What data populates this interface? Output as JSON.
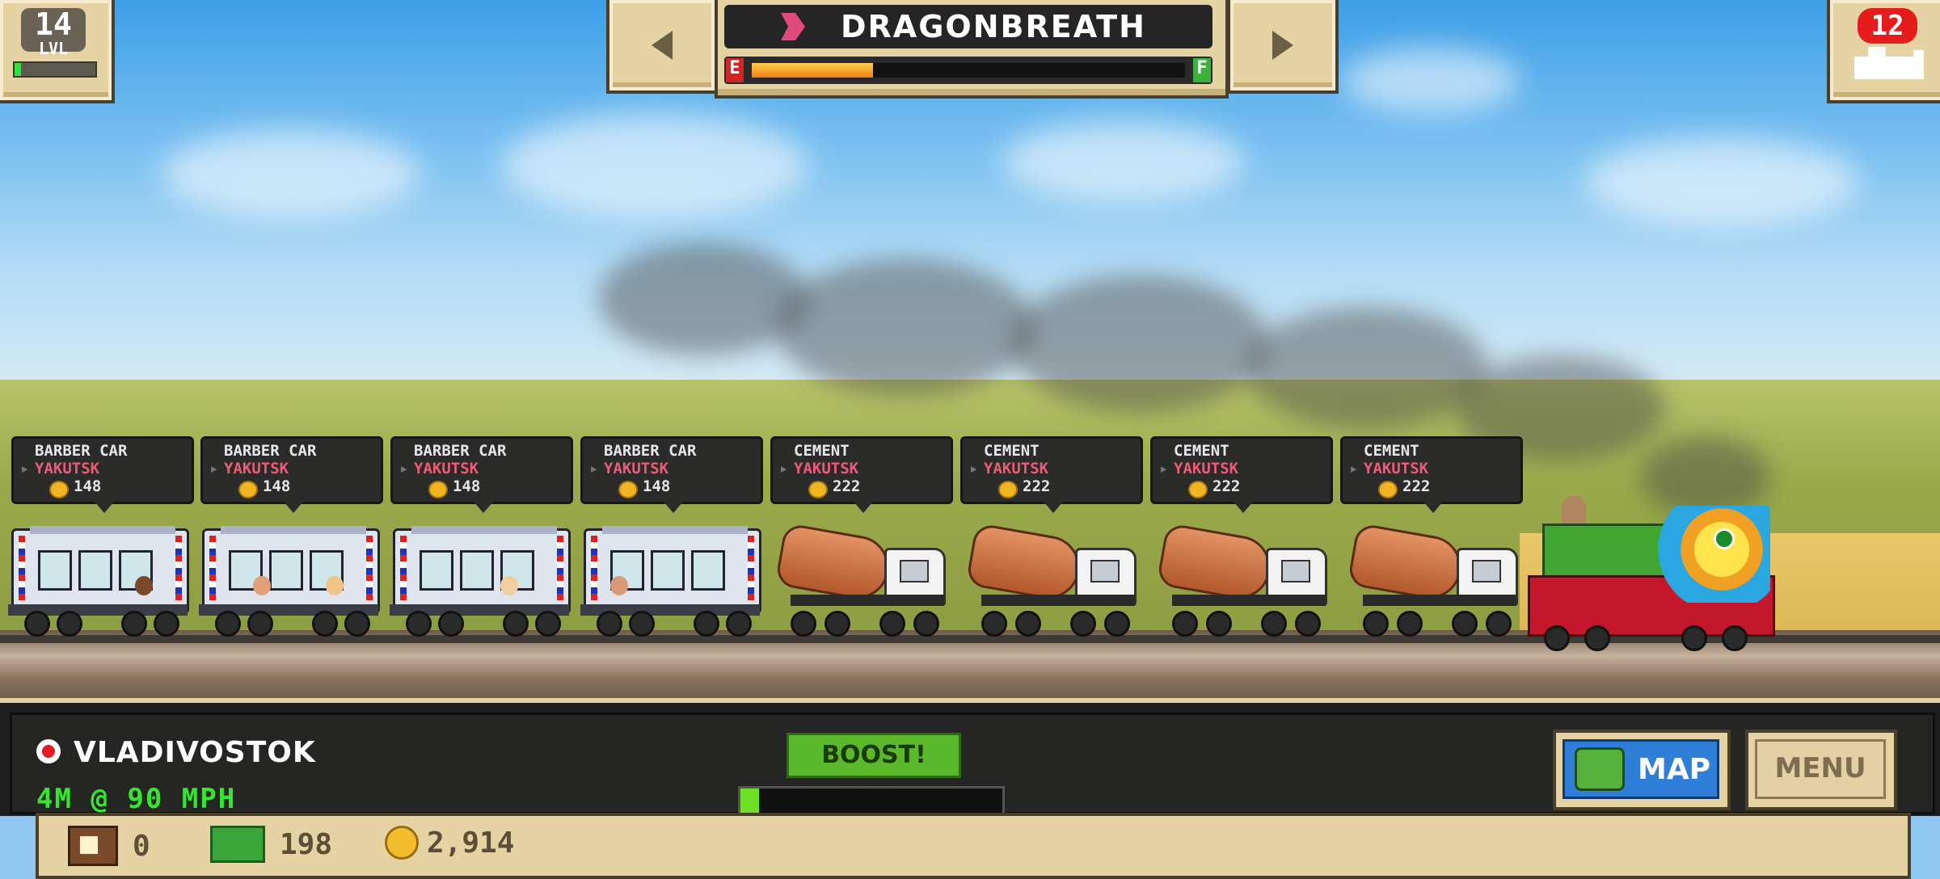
{
  "level": {
    "number": "14",
    "label": "LVL",
    "progress_fraction": 0.08
  },
  "train": {
    "name": "DRAGONBREATH",
    "fuel": {
      "empty_label": "E",
      "full_label": "F",
      "level_fraction": 0.28
    }
  },
  "trains_count": "12",
  "cars": [
    {
      "type": "BARBER CAR",
      "destination": "YAKUTSK",
      "value": "148"
    },
    {
      "type": "BARBER CAR",
      "destination": "YAKUTSK",
      "value": "148"
    },
    {
      "type": "BARBER CAR",
      "destination": "YAKUTSK",
      "value": "148"
    },
    {
      "type": "BARBER CAR",
      "destination": "YAKUTSK",
      "value": "148"
    },
    {
      "type": "CEMENT",
      "destination": "YAKUTSK",
      "value": "222"
    },
    {
      "type": "CEMENT",
      "destination": "YAKUTSK",
      "value": "222"
    },
    {
      "type": "CEMENT",
      "destination": "YAKUTSK",
      "value": "222"
    },
    {
      "type": "CEMENT",
      "destination": "YAKUTSK",
      "value": "222"
    }
  ],
  "hud": {
    "station": "VLADIVOSTOK",
    "status": "4M @ 90 MPH",
    "boost_label": "BOOST!",
    "boost_fraction": 0.07,
    "map_label": "MAP",
    "menu_label": "MENU"
  },
  "resources": {
    "crates": "0",
    "cash": "198",
    "coins": "2,914"
  },
  "colors": {
    "panel": "#e6d3a4",
    "destination": "#ef5b74",
    "speed_text": "#35e631",
    "boost_button": "#5bb82a",
    "map_button": "#2f7fd8"
  }
}
